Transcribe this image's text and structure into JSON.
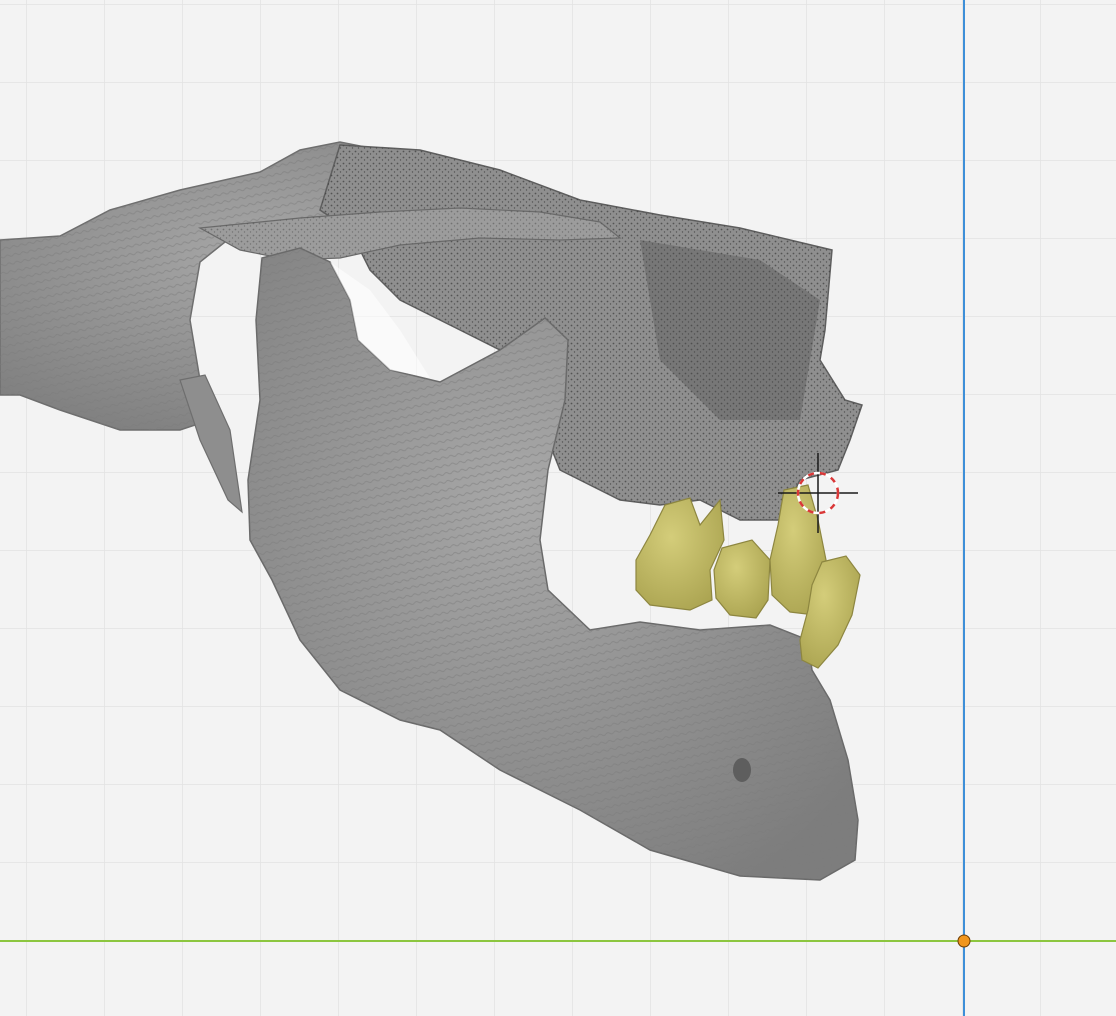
{
  "viewport": {
    "background": "#f3f3f3",
    "grid_color": "#e2e2e2",
    "axis_x_color": "#8cc63f",
    "axis_y_color": "#3d8fd8",
    "origin_color": "#f0961e"
  },
  "model": {
    "bone_color": "#9a9a9a",
    "tooth_color": "#c7c06a"
  },
  "cursor": {
    "ring_colors": [
      "#d93838",
      "#ffffff"
    ],
    "crosshair_color": "#1a1a1a"
  },
  "icons": [
    "3d-cursor-icon",
    "origin-icon"
  ]
}
